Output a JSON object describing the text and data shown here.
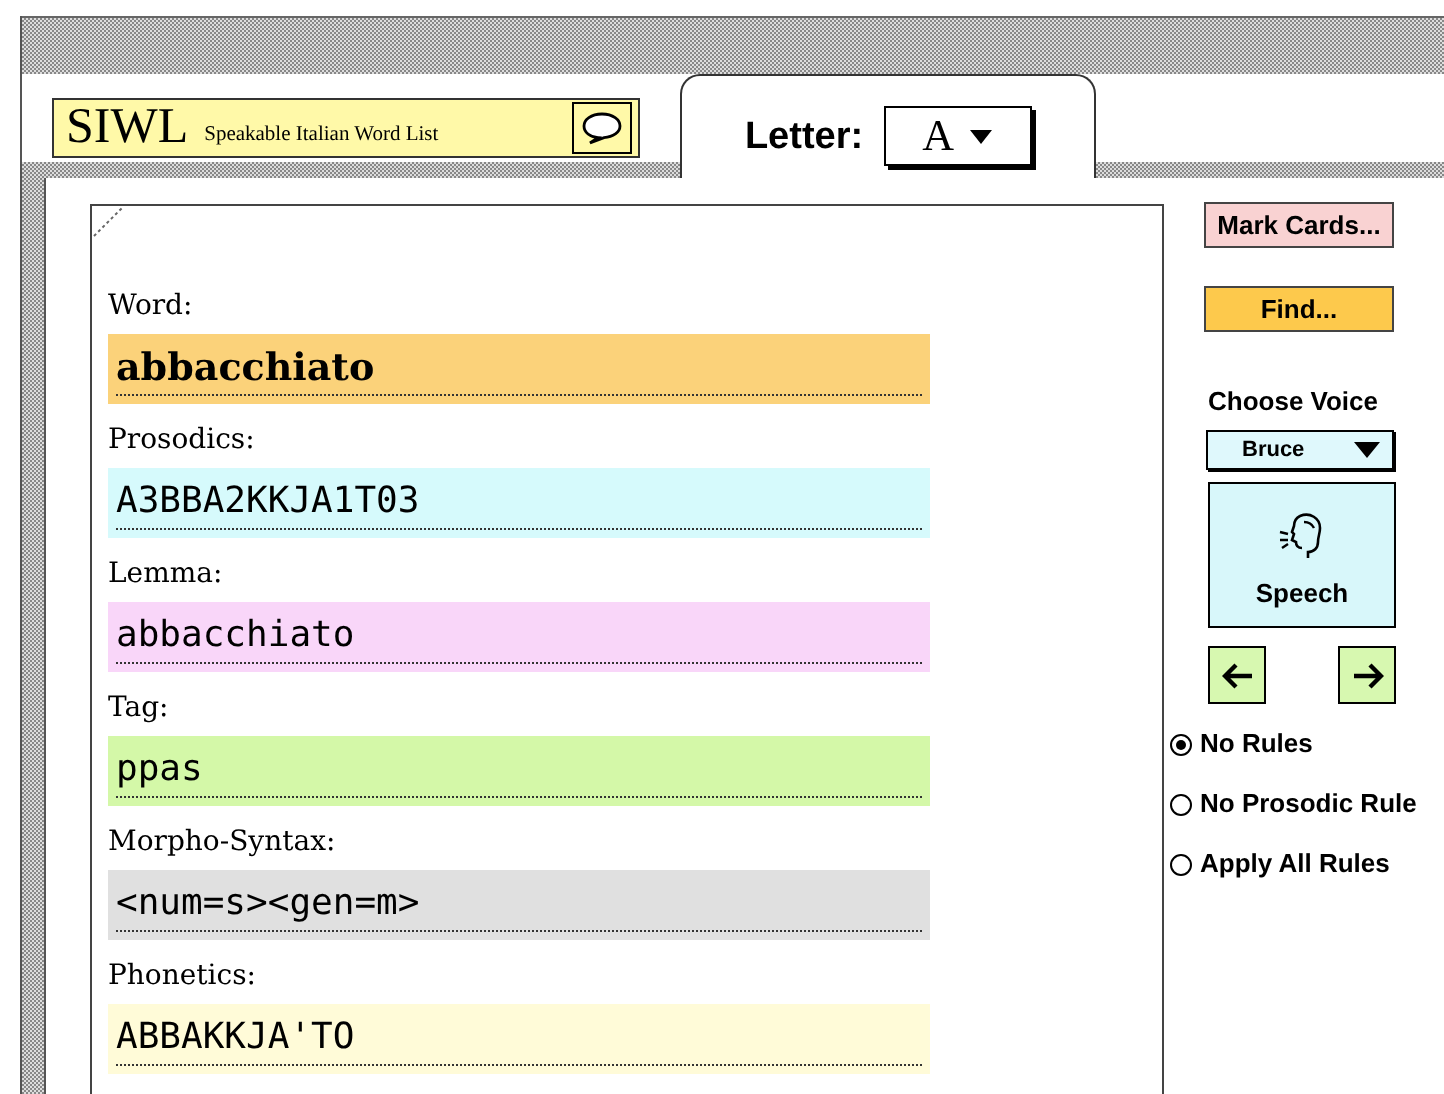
{
  "app": {
    "title": "SIWL",
    "subtitle": "Speakable Italian Word List"
  },
  "letter": {
    "label": "Letter:",
    "value": "A"
  },
  "fields": [
    {
      "label": "Word:",
      "value": "abbacchiato",
      "kind": "word",
      "color": "#fbd27a"
    },
    {
      "label": "Prosodics:",
      "value": "A3BBA2KKJA1T03",
      "kind": "code",
      "color": "#d6fafc"
    },
    {
      "label": "Lemma:",
      "value": "abbacchiato",
      "kind": "code",
      "color": "#f9d6f9"
    },
    {
      "label": "Tag:",
      "value": "ppas",
      "kind": "code",
      "color": "#d4f8a8"
    },
    {
      "label": "Morpho-Syntax:",
      "value": "<num=s><gen=m>",
      "kind": "code",
      "color": "#e0e0e0"
    },
    {
      "label": "Phonetics:",
      "value": "ABBAKKJA'TO",
      "kind": "code",
      "color": "#fffbd8"
    }
  ],
  "buttons": [
    {
      "label": "Mark Cards...",
      "color": "#f9d2d2"
    },
    {
      "label": "Find...",
      "color": "#fdc94c"
    }
  ],
  "voice": {
    "label": "Choose Voice",
    "value": "Bruce"
  },
  "speech": {
    "label": "Speech"
  },
  "rules": [
    {
      "label": "No Rules",
      "selected": true
    },
    {
      "label": "No Prosodic Rule",
      "selected": false
    },
    {
      "label": "Apply All Rules",
      "selected": false
    }
  ]
}
